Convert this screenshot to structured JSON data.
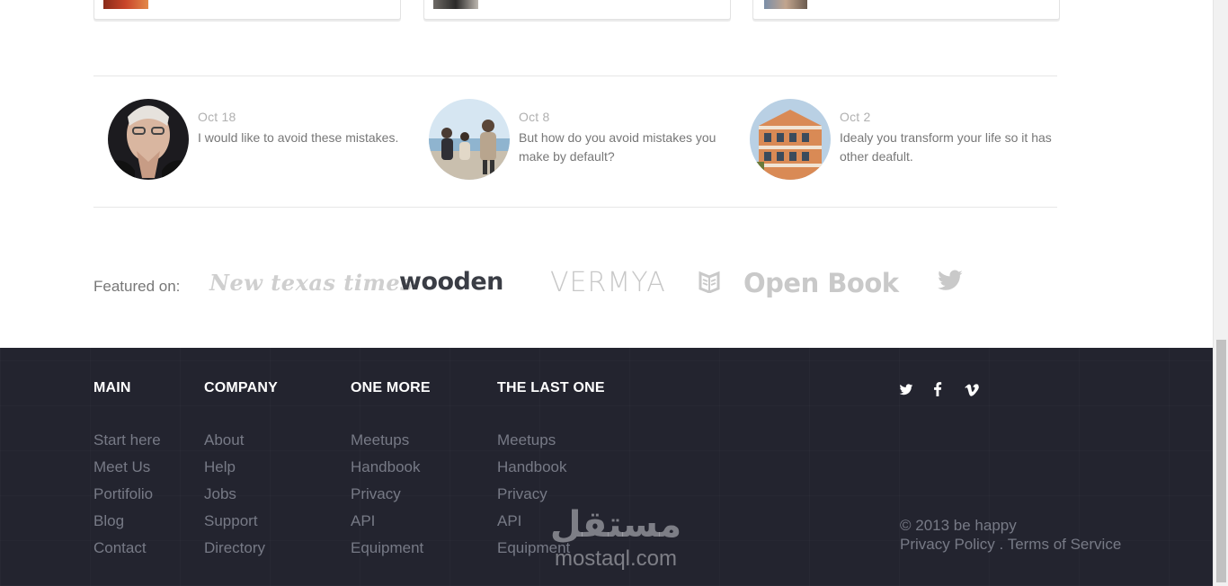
{
  "posts": [
    {
      "date": "Oct 18",
      "text": "I would like to avoid these mistakes."
    },
    {
      "date": "Oct 8",
      "text": "But how do you avoid mistakes you make by default?"
    },
    {
      "date": "Oct 2",
      "text": "Idealy you transform your life so it has other deafult."
    }
  ],
  "featured": {
    "label": "Featured on:",
    "logos": [
      "New texas times",
      "wooden",
      "VERMYA",
      "Open Book"
    ]
  },
  "footer": {
    "columns": [
      {
        "title": "MAIN",
        "items": [
          "Start here",
          "Meet Us",
          "Portifolio",
          "Blog",
          "Contact"
        ]
      },
      {
        "title": "COMPANY",
        "items": [
          "About",
          "Help",
          "Jobs",
          "Support",
          "Directory"
        ]
      },
      {
        "title": "ONE MORE",
        "items": [
          "Meetups",
          "Handbook",
          "Privacy",
          "API",
          "Equipment"
        ]
      },
      {
        "title": "THE LAST ONE",
        "items": [
          "Meetups",
          "Handbook",
          "Privacy",
          "API",
          "Equipment"
        ]
      }
    ],
    "social": [
      "twitter-icon",
      "facebook-icon",
      "vimeo-icon"
    ],
    "copyright": "© 2013 be happy",
    "privacy": "Privacy Policy",
    "separator": " . ",
    "terms": "Terms of Service"
  },
  "watermark": {
    "arabic": "مستقل",
    "latin": "mostaql.com"
  },
  "colors": {
    "footer_bg": "#23242f",
    "footer_link": "#777a86",
    "accent_dark": "#3a3d45"
  }
}
